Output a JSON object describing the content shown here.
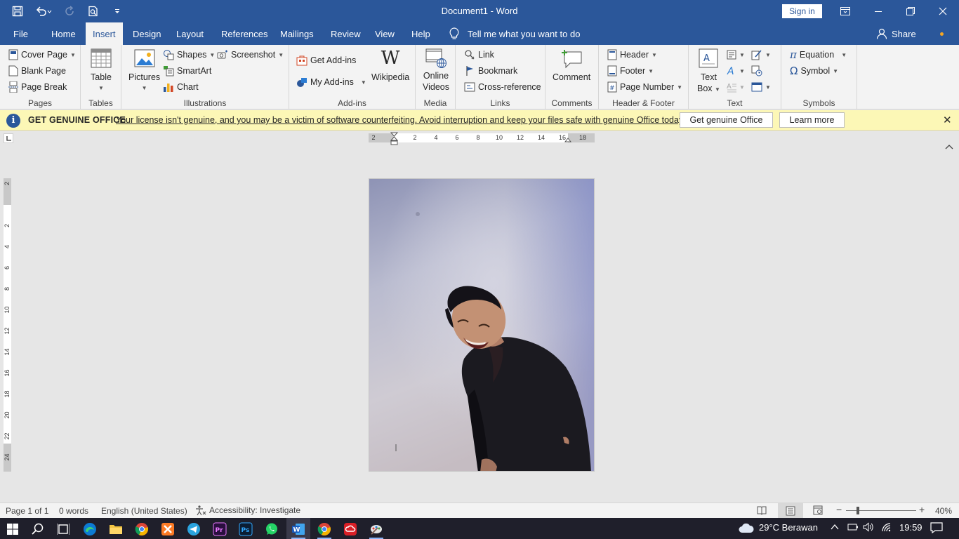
{
  "window": {
    "title": "Document1  -  Word",
    "sign_in": "Sign in"
  },
  "tabs": [
    "File",
    "Home",
    "Insert",
    "Design",
    "Layout",
    "References",
    "Mailings",
    "Review",
    "View",
    "Help"
  ],
  "active_tab": "Insert",
  "tell_me": "Tell me what you want to do",
  "share": "Share",
  "ribbon": {
    "pages": {
      "label": "Pages",
      "cover_page": "Cover Page",
      "blank_page": "Blank Page",
      "page_break": "Page Break"
    },
    "tables": {
      "label": "Tables",
      "table": "Table"
    },
    "illustrations": {
      "label": "Illustrations",
      "pictures": "Pictures",
      "shapes": "Shapes",
      "smartart": "SmartArt",
      "chart": "Chart",
      "screenshot": "Screenshot"
    },
    "addins": {
      "label": "Add-ins",
      "get_addins": "Get Add-ins",
      "my_addins": "My Add-ins",
      "wikipedia": "Wikipedia"
    },
    "media": {
      "label": "Media",
      "online_videos_1": "Online",
      "online_videos_2": "Videos"
    },
    "links": {
      "label": "Links",
      "link": "Link",
      "bookmark": "Bookmark",
      "cross_reference": "Cross-reference"
    },
    "comments": {
      "label": "Comments",
      "comment": "Comment"
    },
    "header_footer": {
      "label": "Header & Footer",
      "header": "Header",
      "footer": "Footer",
      "page_number": "Page Number"
    },
    "text": {
      "label": "Text",
      "text_box_1": "Text",
      "text_box_2": "Box"
    },
    "symbols": {
      "label": "Symbols",
      "equation": "Equation",
      "symbol": "Symbol"
    }
  },
  "message_bar": {
    "title": "GET GENUINE OFFICE",
    "text": "Your license isn't genuine, and you may be a victim of software counterfeiting. Avoid interruption and keep your files safe with genuine Office today.",
    "btn_genuine": "Get genuine Office",
    "btn_learn": "Learn more"
  },
  "ruler": {
    "horizontal": [
      "2",
      "2",
      "4",
      "6",
      "8",
      "10",
      "12",
      "14",
      "16",
      "18"
    ],
    "vertical": [
      "2",
      "2",
      "4",
      "6",
      "8",
      "10",
      "12",
      "14",
      "16",
      "18",
      "20",
      "22",
      "24"
    ]
  },
  "status": {
    "page": "Page 1 of 1",
    "words": "0 words",
    "language": "English (United States)",
    "accessibility": "Accessibility: Investigate",
    "zoom": "40%",
    "zoom_value": 40
  },
  "taskbar": {
    "weather": "29°C  Berawan",
    "time": "19:59",
    "apps": [
      "windows-start",
      "search",
      "task-view",
      "edge",
      "file-explorer",
      "chrome",
      "xampp",
      "telegram",
      "premiere-pro",
      "photoshop",
      "whatsapp",
      "word",
      "chrome-2",
      "creative-cloud",
      "paint-app"
    ]
  },
  "colors": {
    "accent": "#2b579a",
    "message_bar": "#fcf7b6",
    "ribbon": "#f3f3f3",
    "canvas": "#e6e6e6"
  }
}
